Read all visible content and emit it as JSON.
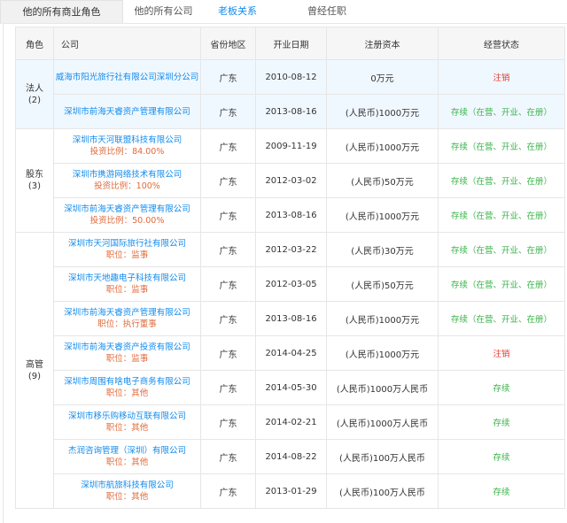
{
  "tabs": [
    {
      "label": "他的所有商业角色",
      "style": "active"
    },
    {
      "label": "他的所有公司",
      "style": "gray"
    },
    {
      "label": "老板关系",
      "style": "blue"
    },
    {
      "label": "曾经任职",
      "style": "gray"
    }
  ],
  "table": {
    "headers": [
      "角色",
      "公司",
      "省份地区",
      "开业日期",
      "注册资本",
      "经营状态"
    ],
    "groups": [
      {
        "role": "法人",
        "count": "(2)",
        "rows": [
          {
            "company": "威海市阳光旅行社有限公司深圳分公司",
            "sub": "",
            "region": "广东",
            "date": "2010-08-12",
            "capital": "0万元",
            "status": "注销",
            "status_color": "#e8382c"
          },
          {
            "company": "深圳市前海天睿资产管理有限公司",
            "sub": "",
            "region": "广东",
            "date": "2013-08-16",
            "capital": "(人民币)1000万元",
            "status": "存续（在营、开业、在册）",
            "status_color": "#3bb34a"
          }
        ]
      },
      {
        "role": "股东",
        "count": "(3)",
        "rows": [
          {
            "company": "深圳市天河联盟科技有限公司",
            "sub": "投资比例：84.00%",
            "region": "广东",
            "date": "2009-11-19",
            "capital": "(人民币)1000万元",
            "status": "存续（在营、开业、在册）",
            "status_color": "#3bb34a"
          },
          {
            "company": "深圳市携游网络技术有限公司",
            "sub": "投资比例：100%",
            "region": "广东",
            "date": "2012-03-02",
            "capital": "(人民币)50万元",
            "status": "存续（在营、开业、在册）",
            "status_color": "#3bb34a"
          },
          {
            "company": "深圳市前海天睿资产管理有限公司",
            "sub": "投资比例：50.00%",
            "region": "广东",
            "date": "2013-08-16",
            "capital": "(人民币)1000万元",
            "status": "存续（在营、开业、在册）",
            "status_color": "#3bb34a"
          }
        ]
      },
      {
        "role": "高管",
        "count": "(9)",
        "rows": [
          {
            "company": "深圳市天河国际旅行社有限公司",
            "sub": "职位：监事",
            "region": "广东",
            "date": "2012-03-22",
            "capital": "(人民币)30万元",
            "status": "存续（在营、开业、在册）",
            "status_color": "#3bb34a"
          },
          {
            "company": "深圳市天地趣电子科技有限公司",
            "sub": "职位：监事",
            "region": "广东",
            "date": "2012-03-05",
            "capital": "(人民币)50万元",
            "status": "存续（在营、开业、在册）",
            "status_color": "#3bb34a"
          },
          {
            "company": "深圳市前海天睿资产管理有限公司",
            "sub": "职位：执行董事",
            "region": "广东",
            "date": "2013-08-16",
            "capital": "(人民币)1000万元",
            "status": "存续（在营、开业、在册）",
            "status_color": "#3bb34a"
          },
          {
            "company": "深圳市前海天睿资产投资有限公司",
            "sub": "职位：监事",
            "region": "广东",
            "date": "2014-04-25",
            "capital": "(人民币)1000万元",
            "status": "注销",
            "status_color": "#e8382c"
          },
          {
            "company": "深圳市周围有啥电子商务有限公司",
            "sub": "职位：其他",
            "region": "广东",
            "date": "2014-05-30",
            "capital": "(人民币)1000万人民币",
            "status": "存续",
            "status_color": "#3bb34a"
          },
          {
            "company": "深圳市移乐购移动互联有限公司",
            "sub": "职位：其他",
            "region": "广东",
            "date": "2014-02-21",
            "capital": "(人民币)1000万人民币",
            "status": "存续",
            "status_color": "#3bb34a"
          },
          {
            "company": "杰润咨询管理（深圳）有限公司",
            "sub": "职位：其他",
            "region": "广东",
            "date": "2014-08-22",
            "capital": "(人民币)100万人民币",
            "status": "存续",
            "status_color": "#3bb34a"
          },
          {
            "company": "深圳市航旅科技有限公司",
            "sub": "职位：其他",
            "region": "广东",
            "date": "2013-01-29",
            "capital": "(人民币)100万人民币",
            "status": "存续",
            "status_color": "#3bb34a"
          }
        ]
      }
    ]
  }
}
